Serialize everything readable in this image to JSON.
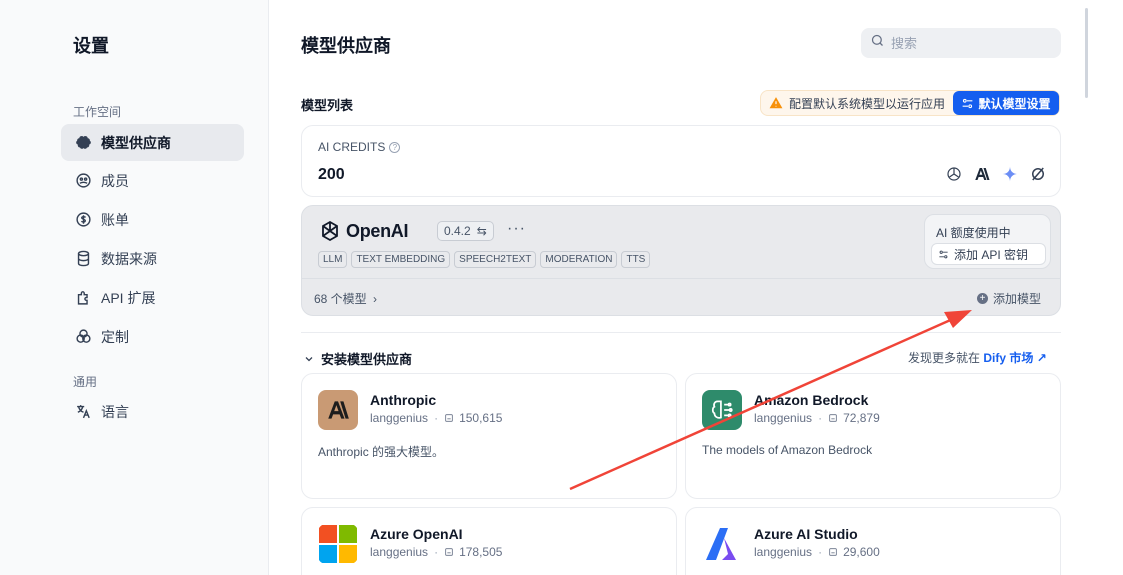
{
  "sidebar": {
    "title": "设置",
    "group_workspace": "工作空间",
    "items": [
      {
        "label": "模型供应商",
        "icon": "brain-icon"
      },
      {
        "label": "成员",
        "icon": "members-icon"
      },
      {
        "label": "账单",
        "icon": "dollar-icon"
      },
      {
        "label": "数据来源",
        "icon": "database-icon"
      },
      {
        "label": "API 扩展",
        "icon": "puzzle-icon"
      },
      {
        "label": "定制",
        "icon": "customize-icon"
      }
    ],
    "group_general": "通用",
    "language": "语言"
  },
  "header": {
    "title": "模型供应商",
    "search_placeholder": "搜索"
  },
  "model_list": {
    "label": "模型列表",
    "warning": "配置默认系统模型以运行应用",
    "default_button": "默认模型设置"
  },
  "credits": {
    "label": "AI CREDITS",
    "help": "?",
    "value": "200"
  },
  "openai": {
    "name": "OpenAI",
    "version": "0.4.2",
    "version_icon": "⇆",
    "more": "···",
    "tags": [
      "LLM",
      "TEXT EMBEDDING",
      "SPEECH2TEXT",
      "MODERATION",
      "TTS"
    ],
    "quota_status": "AI 额度使用中",
    "add_key": "添加 API 密钥",
    "model_count": "68 个模型",
    "model_count_arrow": "›",
    "add_model": "添加模型",
    "add_model_plus": "+"
  },
  "install": {
    "title": "安装模型供应商",
    "discover_prefix": "发现更多就在",
    "discover_link": "Dify 市场 ↗",
    "providers": [
      {
        "name": "Anthropic",
        "author": "langgenius",
        "dot": "·",
        "downloads": "150,615",
        "description": "Anthropic 的强大模型。"
      },
      {
        "name": "Amazon Bedrock",
        "author": "langgenius",
        "dot": "·",
        "downloads": "72,879",
        "description": "The models of Amazon Bedrock"
      },
      {
        "name": "Azure OpenAI",
        "author": "langgenius",
        "dot": "·",
        "downloads": "178,505",
        "description": ""
      },
      {
        "name": "Azure AI Studio",
        "author": "langgenius",
        "dot": "·",
        "downloads": "29,600",
        "description": ""
      }
    ]
  },
  "colors": {
    "accent": "#155eef",
    "warning": "#f79009",
    "annotation_arrow": "#f04438"
  }
}
